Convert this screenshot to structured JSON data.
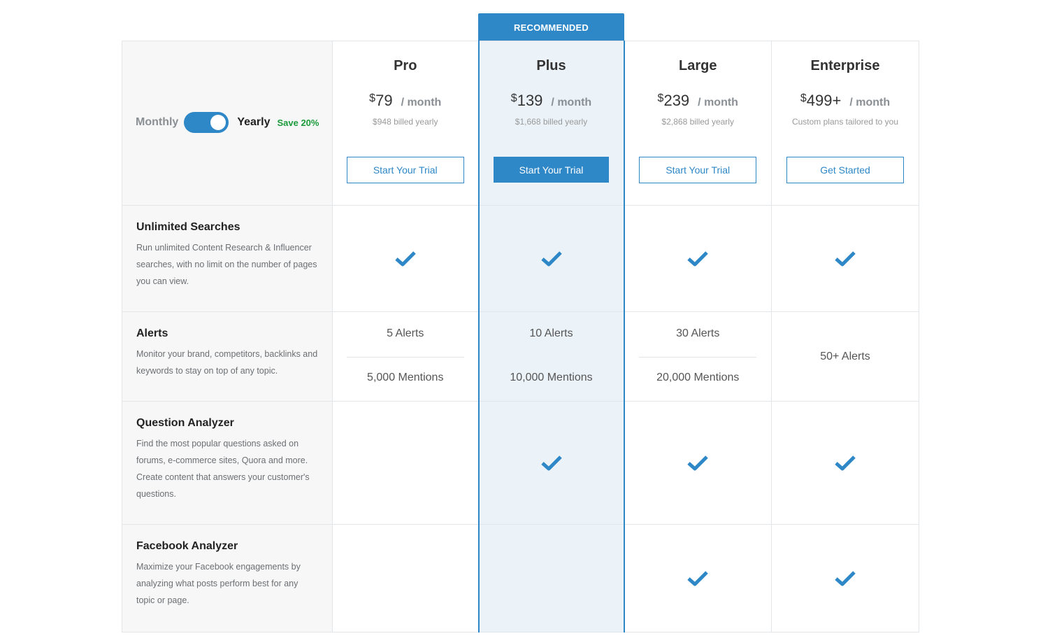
{
  "badge": "RECOMMENDED",
  "toggle": {
    "monthly": "Monthly",
    "yearly": "Yearly",
    "save": "Save 20%"
  },
  "plans": [
    {
      "name": "Pro",
      "currency": "$",
      "amount": "79",
      "per": "/ month",
      "billed": "$948 billed yearly",
      "cta": "Start Your Trial"
    },
    {
      "name": "Plus",
      "currency": "$",
      "amount": "139",
      "per": "/ month",
      "billed": "$1,668 billed yearly",
      "cta": "Start Your Trial"
    },
    {
      "name": "Large",
      "currency": "$",
      "amount": "239",
      "per": "/ month",
      "billed": "$2,868 billed yearly",
      "cta": "Start Your Trial"
    },
    {
      "name": "Enterprise",
      "currency": "$",
      "amount": "499+",
      "per": "/ month",
      "billed": "Custom plans tailored to you",
      "cta": "Get Started"
    }
  ],
  "features": [
    {
      "title": "Unlimited Searches",
      "desc": "Run unlimited Content Research & Influencer searches, with no limit on the number of pages you can view."
    },
    {
      "title": "Alerts",
      "desc": "Monitor your brand, competitors, backlinks and keywords to stay on top of any topic."
    },
    {
      "title": "Question Analyzer",
      "desc": "Find the most popular questions asked on forums, e-commerce sites, Quora and more. Create content that answers your customer's questions."
    },
    {
      "title": "Facebook Analyzer",
      "desc": "Maximize your Facebook engagements by analyzing what posts perform best for any topic or page."
    }
  ],
  "alerts": {
    "pro": {
      "alerts": "5 Alerts",
      "mentions": "5,000 Mentions"
    },
    "plus": {
      "alerts": "10 Alerts",
      "mentions": "10,000 Mentions"
    },
    "large": {
      "alerts": "30 Alerts",
      "mentions": "20,000 Mentions"
    },
    "enterprise": {
      "alerts": "50+ Alerts"
    }
  },
  "icons": {
    "check": "check-icon"
  },
  "colors": {
    "accent": "#2e87c6",
    "save": "#1a9a3a",
    "recommended_bg": "#ebf3f9"
  }
}
